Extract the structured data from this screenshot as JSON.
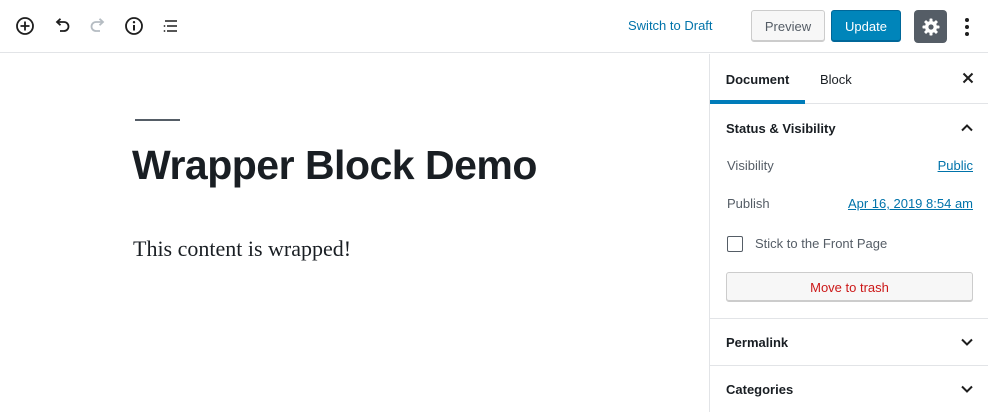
{
  "toolbar": {
    "icons": [
      "add-block-icon",
      "undo-icon",
      "redo-icon",
      "info-icon",
      "outline-icon"
    ],
    "switch_to_draft": "Switch to Draft",
    "preview": "Preview",
    "update": "Update",
    "settings_icon": "gear-icon",
    "more_icon": "vertical-ellipsis-icon"
  },
  "editor": {
    "title": "Wrapper Block Demo",
    "content": "This content is wrapped!"
  },
  "sidebar": {
    "tabs": [
      {
        "label": "Document",
        "active": true
      },
      {
        "label": "Block",
        "active": false
      }
    ],
    "status_visibility": {
      "heading": "Status & Visibility",
      "visibility_label": "Visibility",
      "visibility_value": "Public",
      "publish_label": "Publish",
      "publish_value": "Apr 16, 2019 8:54 am",
      "sticky_label": "Stick to the Front Page",
      "sticky_checked": false,
      "trash": "Move to trash"
    },
    "permalink": "Permalink",
    "categories": "Categories"
  },
  "colors": {
    "accent": "#0085ba",
    "link": "#0073aa",
    "danger": "#cc1818",
    "dark": "#555d66"
  }
}
